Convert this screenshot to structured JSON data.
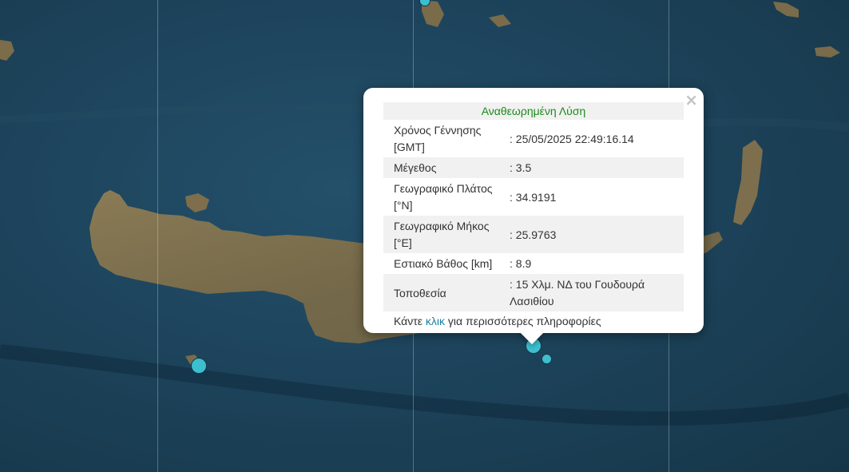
{
  "popup": {
    "title": "Αναθεωρημένη Λύση",
    "close_glyph": "×",
    "rows": [
      {
        "label": "Χρόνος Γέννησης [GMT]",
        "value": ": 25/05/2025 22:49:16.14"
      },
      {
        "label": "Μέγεθος",
        "value": ": 3.5"
      },
      {
        "label": "Γεωγραφικό Πλάτος [°N]",
        "value": ": 34.9191"
      },
      {
        "label": "Γεωγραφικό Μήκος [°E]",
        "value": ": 25.9763"
      },
      {
        "label": "Εστιακό Βάθος [km]",
        "value": ": 8.9"
      },
      {
        "label": "Τοποθεσία",
        "value": ": 15 Χλμ. ΝΔ του Γουδουρά Λασιθίου"
      }
    ],
    "footer_prefix": "Κάντε ",
    "footer_link": "κλικ",
    "footer_suffix": " για περισσότερες πληροφορίες"
  },
  "colors": {
    "sea": "#1d445c",
    "land": "#7e6e4c",
    "marker": "#3dbfcf",
    "title_green": "#1a8a1a",
    "link_blue": "#1a7fa8"
  }
}
